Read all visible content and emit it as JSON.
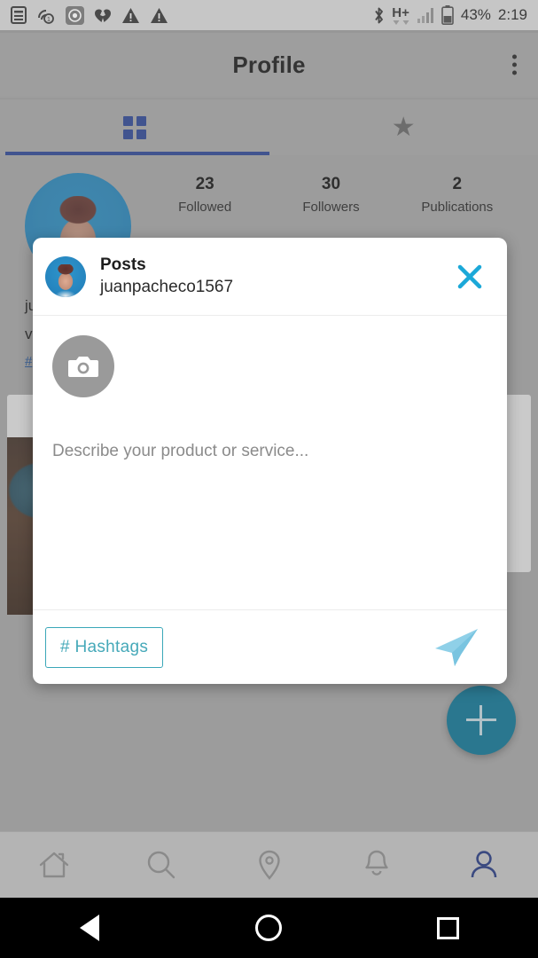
{
  "status_bar": {
    "left_icons": [
      "sim-card-icon",
      "cast-warning-icon",
      "screen-record-icon",
      "broken-heart-icon",
      "warning-triangle-icon",
      "warning-triangle-icon"
    ],
    "bluetooth_icon": "bluetooth-icon",
    "network_type": "H+",
    "signal_icon": "signal-bars-icon",
    "battery_icon": "battery-icon",
    "battery_percent": "43%",
    "clock": "2:19"
  },
  "appbar": {
    "title": "Profile",
    "overflow_icon": "more-vertical-icon"
  },
  "tabs": [
    {
      "name": "grid",
      "icon": "grid-icon",
      "active": true
    },
    {
      "name": "starred",
      "icon": "star-icon",
      "active": false
    }
  ],
  "profile": {
    "avatar_icon": "profile-avatar",
    "stats": [
      {
        "value": "23",
        "label": "Followed"
      },
      {
        "value": "30",
        "label": "Followers"
      },
      {
        "value": "2",
        "label": "Publications"
      }
    ],
    "bio_lines": [
      "ju",
      "v"
    ],
    "bio_tag": "#",
    "fab_icon": "plus-icon"
  },
  "modal": {
    "avatar_icon": "user-avatar",
    "title": "Posts",
    "username": "juanpacheco1567",
    "close_icon": "close-x-icon",
    "camera_icon": "camera-icon",
    "description_placeholder": "Describe your product or service...",
    "hashtags_label": "# Hashtags",
    "send_icon": "send-paper-plane-icon"
  },
  "bottom_nav": [
    {
      "name": "home",
      "icon": "home-icon",
      "active": false
    },
    {
      "name": "search",
      "icon": "search-icon",
      "active": false
    },
    {
      "name": "location",
      "icon": "location-pin-icon",
      "active": false
    },
    {
      "name": "notifications",
      "icon": "bell-icon",
      "active": false
    },
    {
      "name": "profile",
      "icon": "person-icon",
      "active": true
    }
  ],
  "android_nav": {
    "back_icon": "back-triangle-icon",
    "home_icon": "home-circle-icon",
    "recents_icon": "recents-square-icon"
  },
  "colors": {
    "accent_blue": "#2e4a9e",
    "teal": "#0d7c9e",
    "close_cyan": "#1ba8d8",
    "hashtag_border": "#3aa7b8",
    "send_blue": "#8fd0e8"
  }
}
